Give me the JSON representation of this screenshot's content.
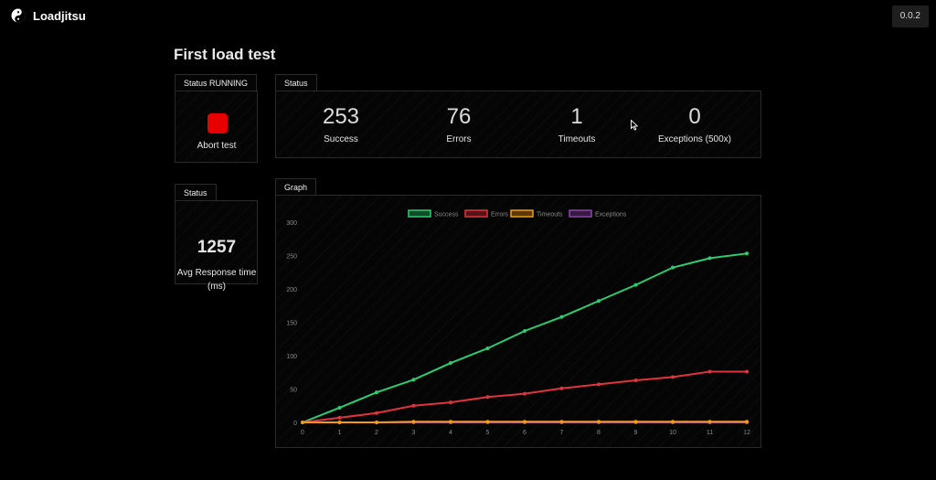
{
  "app": {
    "name": "Loadjitsu",
    "version": "0.0.2"
  },
  "page": {
    "title": "First load test"
  },
  "abort_panel": {
    "tab": "Status RUNNING",
    "button_label": "Abort test"
  },
  "status_panel": {
    "tab": "Status",
    "stats": [
      {
        "value": "253",
        "label": "Success"
      },
      {
        "value": "76",
        "label": "Errors"
      },
      {
        "value": "1",
        "label": "Timeouts"
      },
      {
        "value": "0",
        "label": "Exceptions (500x)"
      }
    ]
  },
  "avg_panel": {
    "tab": "Status",
    "value": "1257",
    "label": "Avg Response time (ms)"
  },
  "graph_panel": {
    "tab": "Graph"
  },
  "chart_data": {
    "type": "line",
    "x": [
      0,
      1,
      2,
      3,
      4,
      5,
      6,
      7,
      8,
      9,
      10,
      11,
      12
    ],
    "ylim": [
      0,
      300
    ],
    "yticks": [
      0,
      50,
      100,
      150,
      200,
      250,
      300
    ],
    "grid": false,
    "legend": "top-center",
    "series": [
      {
        "name": "Success",
        "color": "#2ecc71",
        "values": [
          0,
          22,
          45,
          64,
          89,
          111,
          137,
          158,
          182,
          206,
          232,
          246,
          253
        ]
      },
      {
        "name": "Errors",
        "color": "#e0333c",
        "values": [
          0,
          7,
          14,
          25,
          30,
          38,
          43,
          51,
          57,
          63,
          68,
          76,
          76
        ]
      },
      {
        "name": "Timeouts",
        "color": "#f39c12",
        "values": [
          0,
          0,
          0,
          1,
          1,
          1,
          1,
          1,
          1,
          1,
          1,
          1,
          1
        ]
      },
      {
        "name": "Exceptions",
        "color": "#8e44ad",
        "values": [
          0,
          0,
          0,
          0,
          0,
          0,
          0,
          0,
          0,
          0,
          0,
          0,
          0
        ]
      }
    ]
  }
}
